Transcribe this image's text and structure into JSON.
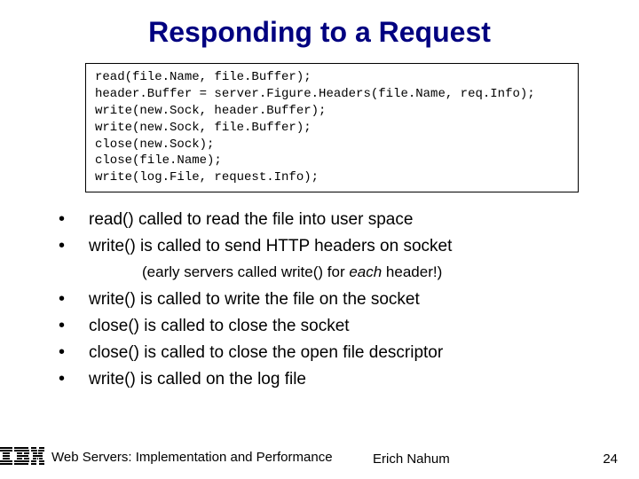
{
  "title": "Responding to a Request",
  "code": {
    "l1": "read(file.Name, file.Buffer);",
    "l2": "header.Buffer = server.Figure.Headers(file.Name, req.Info);",
    "l3": "write(new.Sock, header.Buffer);",
    "l4": "write(new.Sock, file.Buffer);",
    "l5": "close(new.Sock);",
    "l6": "close(file.Name);",
    "l7": "write(log.File, request.Info);"
  },
  "bullets": {
    "b1": "read() called to read the file into user space",
    "b2": "write() is called to send HTTP headers on socket",
    "note_a": "(early servers called write() for ",
    "note_b": "each",
    "note_c": " header!)",
    "b3": "write() is called to write the file on the socket",
    "b4": "close() is called to close the socket",
    "b5": "close() is called to close the open file descriptor",
    "b6": "write() is called on the log file"
  },
  "footer": {
    "left": "Web Servers: Implementation and Performance",
    "center": "Erich Nahum",
    "right": "24"
  },
  "logo": {
    "name": "IBM"
  }
}
